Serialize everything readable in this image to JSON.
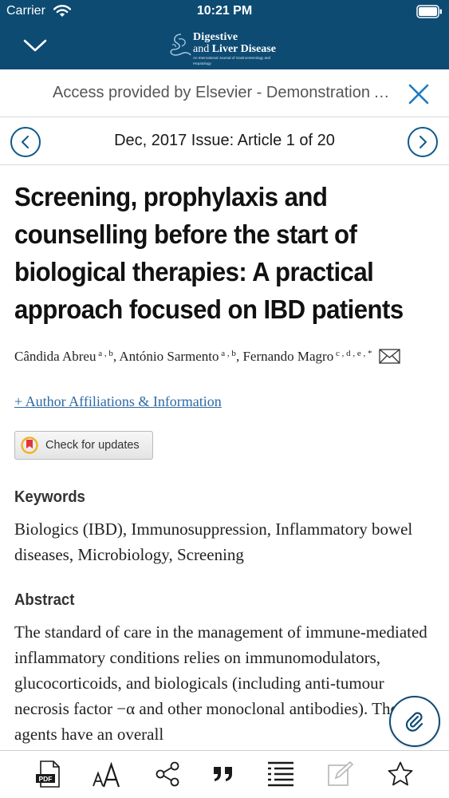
{
  "status_bar": {
    "carrier": "Carrier",
    "time": "10:21 PM"
  },
  "header": {
    "logo_line1": "Digestive",
    "logo_line2_light": "and ",
    "logo_line2_bold": "Liver Disease",
    "logo_tagline": "An International Journal of Gastroenterology and Hepatology"
  },
  "access_banner": {
    "text": "Access provided by Elsevier - Demonstration Account"
  },
  "issue_nav": {
    "label": "Dec, 2017 Issue: Article 1 of 20"
  },
  "article": {
    "title": "Screening, prophylaxis and counselling before the start of biological therapies: A practical approach focused on IBD patients",
    "authors": [
      {
        "name": "Cândida Abreu",
        "sup": "a , b"
      },
      {
        "name": "António Sarmento",
        "sup": "a , b"
      },
      {
        "name": "Fernando Magro",
        "sup": "c , d , e , *"
      }
    ],
    "affiliations_link": "+ Author Affiliations & Information",
    "check_updates_label": "Check for updates",
    "keywords_heading": "Keywords",
    "keywords": "Biologics (IBD), Immunosuppression, Inflammatory bowel diseases, Microbiology, Screening",
    "abstract_heading": "Abstract",
    "abstract": "The standard of care in the management of immune-mediated inflammatory conditions relies on immunomodulators, glucocorticoids, and biologicals (including anti-tumour necrosis factor −α and other monoclonal antibodies). These agents have an overall"
  },
  "toolbar": {
    "items": [
      "pdf-icon",
      "text-size-icon",
      "share-icon",
      "quote-icon",
      "outline-icon",
      "note-icon",
      "star-icon"
    ]
  },
  "colors": {
    "header_bg": "#0d4b73",
    "accent": "#0d5a8c",
    "link": "#2d6aa3"
  }
}
